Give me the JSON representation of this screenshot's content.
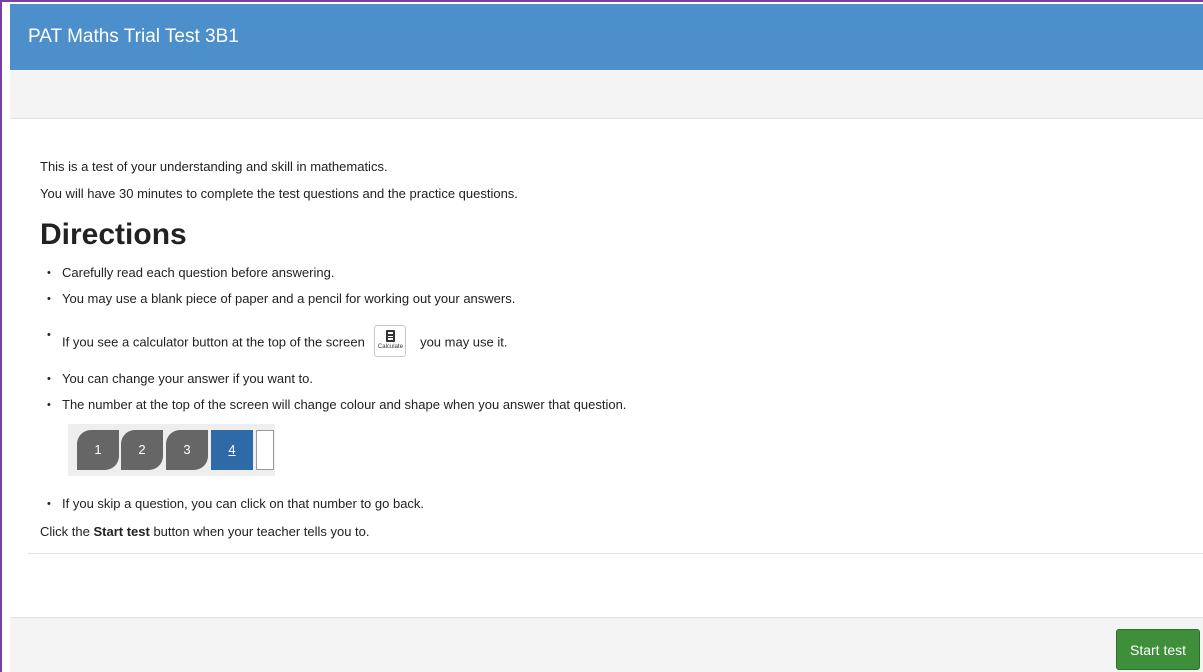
{
  "header": {
    "title": "PAT Maths Trial Test 3B1"
  },
  "intro": {
    "line1": "This is a test of your understanding and skill in mathematics.",
    "line2": "You will have 30 minutes to complete the test questions and the practice questions."
  },
  "directions": {
    "heading": "Directions",
    "items": [
      "Carefully read each question before answering.",
      "You may use a blank piece of paper and a pencil for working out your answers.",
      "If you see a calculator button at the top of the screen",
      "You can change your answer if you want to.",
      "The number at the top of the screen will change colour and shape when you answer that question.",
      "If you skip a question, you can click on that number to go back."
    ],
    "calc_suffix": "you may use it.",
    "calc_label": "Calculate",
    "calc_icon": "calculator-icon"
  },
  "question_nav": {
    "numbers": [
      "1",
      "2",
      "3",
      "4"
    ],
    "current": "4"
  },
  "final": {
    "prefix": "Click the ",
    "bold": "Start test",
    "suffix": " button when your teacher tells you to."
  },
  "footer": {
    "start_label": "Start test"
  },
  "colors": {
    "header_bg": "#4d8fcb",
    "start_button": "#3e8e3a",
    "answered_question": "#666666",
    "current_question": "#2e6aa8"
  }
}
